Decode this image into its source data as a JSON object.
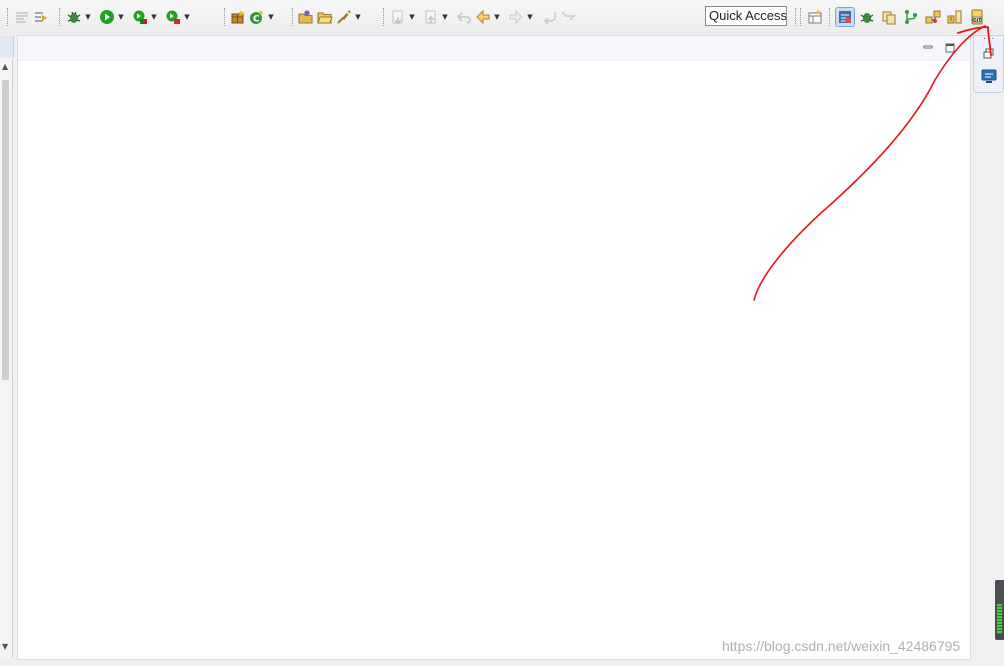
{
  "toolbar": {
    "quick_access_label": "Quick Access"
  },
  "icons": {
    "left": [
      "show-whitespace-icon",
      "next-annotation-icon",
      "debug-icon",
      "run-icon",
      "coverage-icon",
      "external-tools-icon",
      "new-java-package-icon",
      "new-class-icon",
      "open-type-icon",
      "open-folder-icon",
      "search-icon",
      "next-edit-icon",
      "prev-edit-icon",
      "last-edit-location-icon",
      "back-icon",
      "forward-icon",
      "undo-icon",
      "redo-icon"
    ],
    "right": [
      "open-perspective-icon",
      "java-ee-perspective-icon",
      "debug-perspective-icon",
      "resource-perspective-icon",
      "git-perspective-icon",
      "team-sync-perspective-icon",
      "svn-perspective-icon",
      "git-icon"
    ]
  },
  "colors": {
    "annotation": "#e8141b",
    "selected_perspective": "#c9dcf2",
    "run_green": "#1fa21f",
    "accent_blue": "#1f6fb5"
  },
  "watermark": "https://blog.csdn.net/weixin_42486795"
}
